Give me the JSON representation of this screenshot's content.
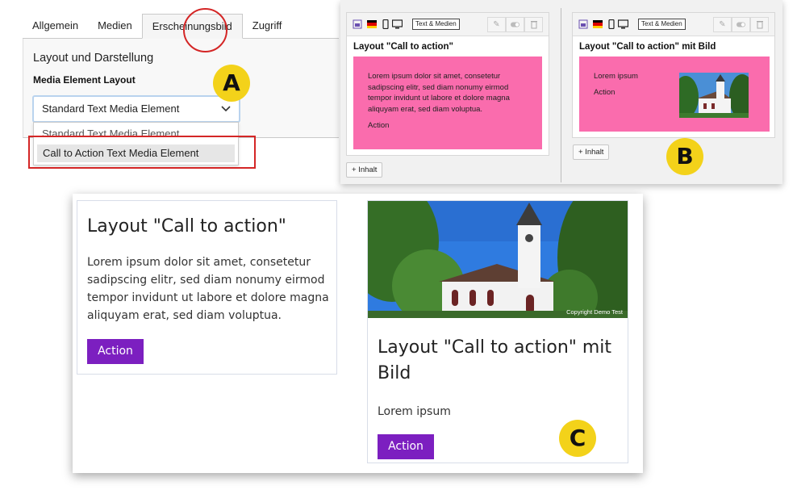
{
  "panel_a": {
    "tabs": [
      {
        "label": "Allgemein",
        "active": false
      },
      {
        "label": "Medien",
        "active": false
      },
      {
        "label": "Erscheinungsbild",
        "active": true
      },
      {
        "label": "Zugriff",
        "active": false
      }
    ],
    "section_title": "Layout und Darstellung",
    "field_label": "Media Element Layout",
    "select_value": "Standard Text Media Element",
    "options": [
      "Standard Text Media Element",
      "Call to Action Text Media Element"
    ],
    "highlighted_option": "Call to Action Text Media Element",
    "badge": "A"
  },
  "panel_b": {
    "badge": "B",
    "cards": [
      {
        "tag": "Text & Medien",
        "title": "Layout \"Call to action\"",
        "text": "Lorem ipsum dolor sit amet, consetetur sadipscing elitr, sed diam nonumy eirmod tempor invidunt ut labore et dolore magna aliquyam erat, sed diam voluptua.",
        "action": "Action",
        "add_button": "Inhalt"
      },
      {
        "tag": "Text & Medien",
        "title": "Layout \"Call to action\" mit Bild",
        "text": "Lorem ipsum",
        "action": "Action",
        "add_button": "Inhalt"
      }
    ],
    "pink_color": "#fa6cad"
  },
  "panel_c": {
    "badge": "C",
    "card1": {
      "title": "Layout \"Call to action\"",
      "text": "Lorem ipsum dolor sit amet, consetetur sadipscing elitr, sed diam nonumy eirmod tempor invidunt ut labore et dolore magna aliquyam erat, sed diam voluptua.",
      "button": "Action"
    },
    "card2": {
      "copyright": "Copyright Demo Test",
      "title": "Layout \"Call to action\" mit Bild",
      "text": "Lorem ipsum",
      "button": "Action"
    },
    "button_color": "#7c1fc0"
  }
}
